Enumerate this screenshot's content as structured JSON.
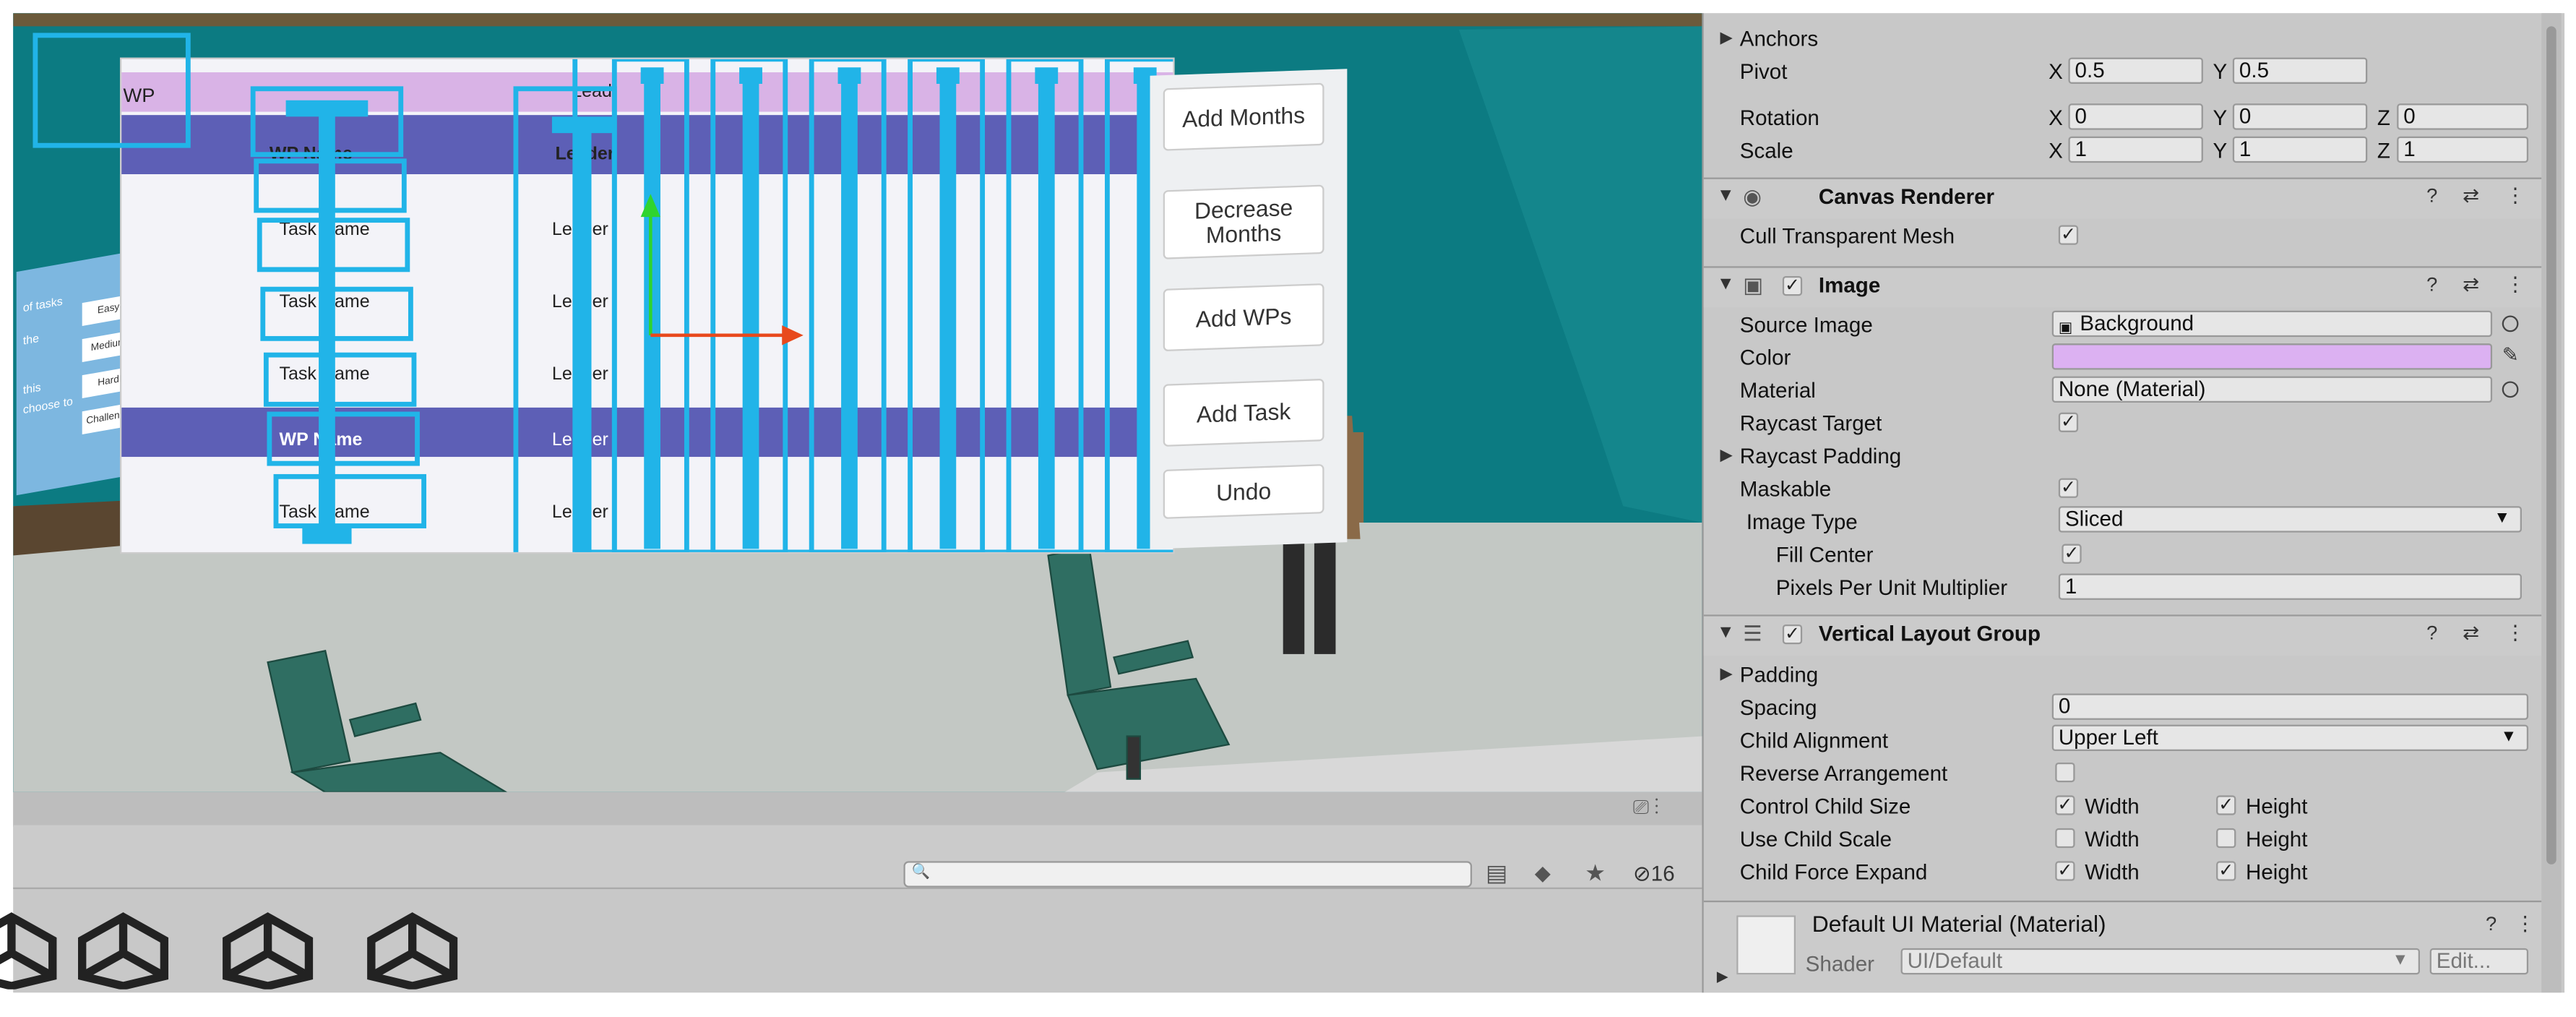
{
  "scene": {
    "wp_tag": "WP",
    "header_fragment": "Lead",
    "columns": {
      "wp_name": "WP Name",
      "leader": "Leader"
    },
    "rows": [
      {
        "name": "Task Name",
        "leader": "Leader"
      },
      {
        "name": "Task Name",
        "leader": "Leader"
      },
      {
        "name": "Task Name",
        "leader": "Leader"
      },
      {
        "name": "WP Name",
        "leader": "Leader"
      },
      {
        "name": "Task Name",
        "leader": "Leader"
      }
    ],
    "buttons": [
      {
        "label": "Add Months"
      },
      {
        "label": "Decrease Months"
      },
      {
        "label": "Add WPs"
      },
      {
        "label": "Add Task"
      },
      {
        "label": "Undo"
      }
    ],
    "left_panel": {
      "texts": [
        "of tasks",
        "the",
        "this",
        "choose to"
      ],
      "buttons": [
        "Easy",
        "Medium",
        "Hard",
        "Challenge"
      ]
    },
    "highlight_color": "#21b4e8",
    "header_color": "#d9b3e6"
  },
  "project": {
    "search_placeholder": "",
    "hidden_count": "16",
    "icons": [
      "filter-icon",
      "tag-icon",
      "star-icon",
      "eye-slash-icon"
    ]
  },
  "inspector": {
    "anchors_label": "Anchors",
    "pivot": {
      "label": "Pivot",
      "x": "0.5",
      "y": "0.5"
    },
    "rotation": {
      "label": "Rotation",
      "x": "0",
      "y": "0",
      "z": "0"
    },
    "scale": {
      "label": "Scale",
      "x": "1",
      "y": "1",
      "z": "1"
    },
    "axes": {
      "x": "X",
      "y": "Y",
      "z": "Z"
    },
    "canvas_renderer": {
      "title": "Canvas Renderer",
      "cull_label": "Cull Transparent Mesh",
      "cull": true
    },
    "image": {
      "title": "Image",
      "source_image_label": "Source Image",
      "source_image": "Background",
      "color_label": "Color",
      "color": "#dcb1f2",
      "material_label": "Material",
      "material": "None (Material)",
      "raycast_target_label": "Raycast Target",
      "raycast_padding_label": "Raycast Padding",
      "maskable_label": "Maskable",
      "image_type_label": "Image Type",
      "image_type": "Sliced",
      "fill_center_label": "Fill Center",
      "ppu_label": "Pixels Per Unit Multiplier",
      "ppu": "1"
    },
    "vlg": {
      "title": "Vertical Layout Group",
      "padding_label": "Padding",
      "spacing_label": "Spacing",
      "spacing": "0",
      "child_alignment_label": "Child Alignment",
      "child_alignment": "Upper Left",
      "reverse_label": "Reverse Arrangement",
      "control_label": "Control Child Size",
      "use_scale_label": "Use Child Scale",
      "force_label": "Child Force Expand",
      "width": "Width",
      "height": "Height"
    },
    "material": {
      "title": "Default UI Material (Material)",
      "shader_label": "Shader",
      "shader": "UI/Default",
      "edit": "Edit..."
    }
  }
}
